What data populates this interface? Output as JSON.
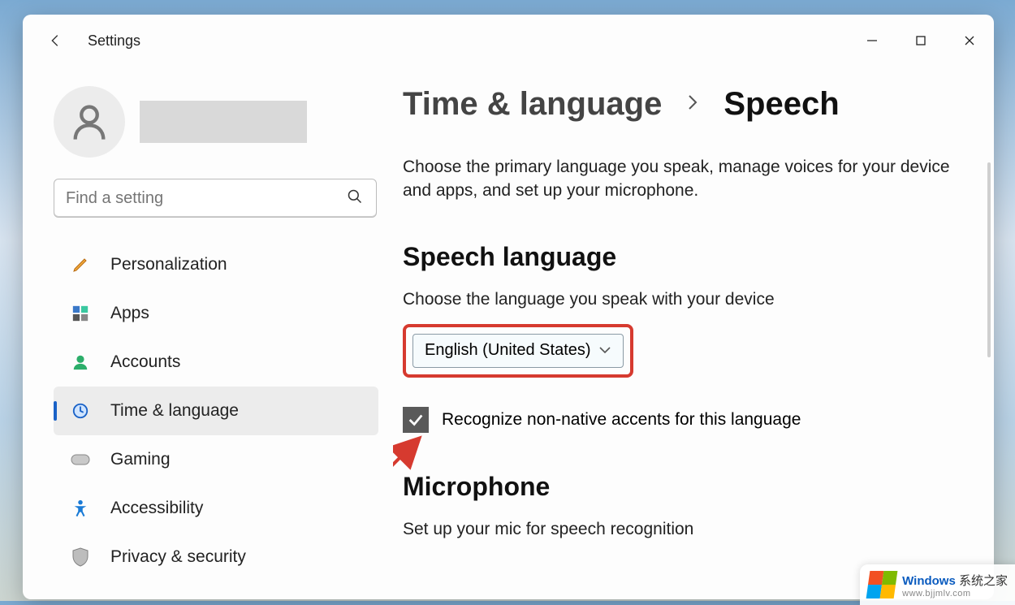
{
  "app_title": "Settings",
  "window_controls": {
    "min": "minimize",
    "max": "maximize",
    "close": "close"
  },
  "profile": {
    "username": ""
  },
  "search": {
    "placeholder": "Find a setting"
  },
  "nav": {
    "items": [
      {
        "label": "Personalization",
        "icon": "brush"
      },
      {
        "label": "Apps",
        "icon": "apps"
      },
      {
        "label": "Accounts",
        "icon": "person"
      },
      {
        "label": "Time & language",
        "icon": "globe-clock",
        "selected": true
      },
      {
        "label": "Gaming",
        "icon": "gamepad"
      },
      {
        "label": "Accessibility",
        "icon": "accessibility"
      },
      {
        "label": "Privacy & security",
        "icon": "shield"
      }
    ]
  },
  "breadcrumb": {
    "parent": "Time & language",
    "current": "Speech"
  },
  "description": "Choose the primary language you speak, manage voices for your device and apps, and set up your microphone.",
  "speech_language": {
    "heading": "Speech language",
    "subheading": "Choose the language you speak with your device",
    "selected": "English (United States)",
    "checkbox_label": "Recognize non-native accents for this language",
    "checkbox_checked": true
  },
  "microphone": {
    "heading": "Microphone",
    "subheading": "Set up your mic for speech recognition"
  },
  "watermark": {
    "brand": "Windows",
    "suffix": " 系统之家",
    "url": "www.bjjmlv.com"
  }
}
